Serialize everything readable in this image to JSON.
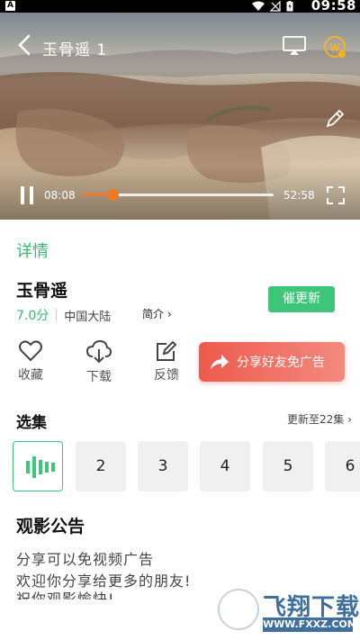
{
  "status_bar": {
    "time": "09:58",
    "app_icon_letter": "A",
    "icons": [
      "wifi-icon",
      "no-signal-icon",
      "battery-charging-icon"
    ]
  },
  "player": {
    "title": "玉骨遥 1",
    "current_time": "08:08",
    "total_time": "52:58",
    "progress": 0.155,
    "accent_color": "#f07828",
    "icons": [
      "back-icon",
      "cast-icon",
      "vip-icon",
      "pen-icon",
      "pause-icon",
      "fullscreen-icon"
    ]
  },
  "details": {
    "tab_label": "详情",
    "title": "玉骨遥",
    "score": "7.0分",
    "region": "中国大陆",
    "intro_label": "简介 ›",
    "urge_button": "催更新",
    "accent_color": "#3ec57a"
  },
  "actions": [
    {
      "label": "收藏",
      "icon": "heart-icon"
    },
    {
      "label": "下载",
      "icon": "cloud-download-icon"
    },
    {
      "label": "反馈",
      "icon": "feedback-edit-icon"
    }
  ],
  "share_button": {
    "label": "分享好友免广告",
    "icon": "share-arrow-icon"
  },
  "episodes": {
    "heading": "选集",
    "update_label": "更新至22集 ›",
    "items": [
      "",
      "2",
      "3",
      "4",
      "5",
      "6"
    ],
    "active_index": 0
  },
  "notice": {
    "heading": "观影公告",
    "lines": [
      "分享可以免视频广告",
      "欢迎你分享给更多的朋友!",
      "祝你观影愉快!"
    ]
  },
  "watermark": {
    "text": "飞翔下载",
    "url": "WWW.FXXZ.COM"
  }
}
